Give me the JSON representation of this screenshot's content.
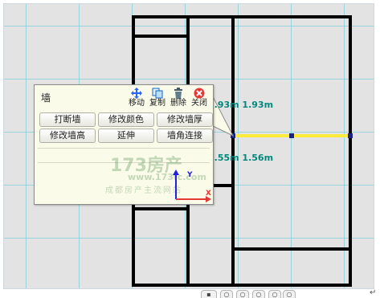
{
  "floor_plan": {
    "dimension_top": "1.93m  1.93m",
    "dimension_bottom": "1.55m  1.56m",
    "colors": {
      "wall": "#000000",
      "selected_wall": "#ffeb3b",
      "selection_handle": "#1a237e",
      "grid": "#78cdd7",
      "dimension_text": "#00897b"
    }
  },
  "wall_panel": {
    "title": "墙",
    "toolbar": {
      "move": {
        "label": "移动",
        "icon": "move-arrows-icon"
      },
      "copy": {
        "label": "复制",
        "icon": "copy-icon"
      },
      "delete": {
        "label": "删除",
        "icon": "trash-icon"
      },
      "close": {
        "label": "关闭",
        "icon": "close-circle-icon"
      }
    },
    "buttons": {
      "break_wall": "打断墙",
      "change_color": "修改颜色",
      "change_thickness": "修改墙厚",
      "change_height": "修改墙高",
      "extend": "延伸",
      "corner_connect": "墙角连接"
    },
    "axis": {
      "y": "Y",
      "x": "X"
    }
  },
  "watermark": {
    "logo": "173房产",
    "url": "www.173fc.com",
    "slogan": "成都房产主流网站"
  },
  "bottom_bar": {
    "icons": [
      "page-icon",
      "circle-icon",
      "circle-icon",
      "circle-icon",
      "circle-icon",
      "circle-icon"
    ]
  }
}
